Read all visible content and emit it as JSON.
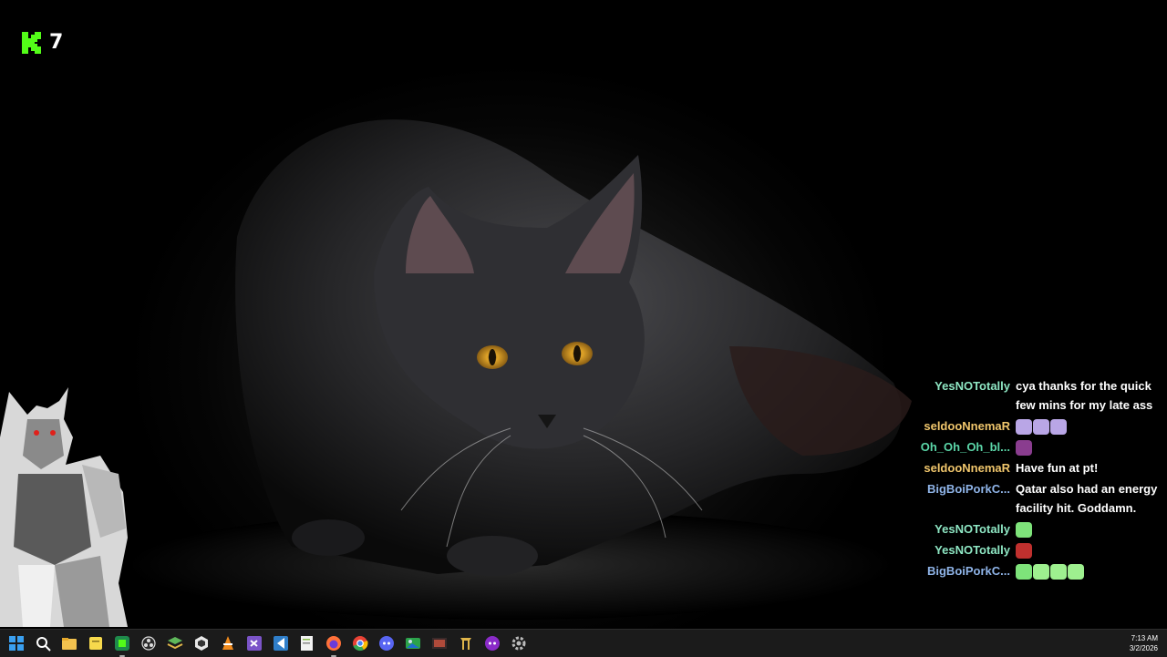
{
  "kick": {
    "viewer_count": "7"
  },
  "chat": {
    "messages": [
      {
        "user": "YesNOTotally",
        "color": "#8ee6c3",
        "text": "cya thanks for the quick few mins for my late ass"
      },
      {
        "user": "seldooNnemaR",
        "color": "#f0c66c",
        "text": "",
        "emotes": [
          "ghost-purple-emote",
          "ghost-purple-emote",
          "ghost-purple-emote"
        ]
      },
      {
        "user": "Oh_Oh_Oh_bl...",
        "color": "#5bd6a8",
        "text": "",
        "emotes": [
          "small-avatar-emote"
        ]
      },
      {
        "user": "seldooNnemaR",
        "color": "#f0c66c",
        "text": "Have fun at pt!"
      },
      {
        "user": "BigBoiPorkC...",
        "color": "#8fb4e8",
        "text": "Qatar also had an energy facility hit. Goddamn."
      },
      {
        "user": "YesNOTotally",
        "color": "#8ee6c3",
        "text": "",
        "emotes": [
          "green-frog-emote"
        ]
      },
      {
        "user": "YesNOTotally",
        "color": "#8ee6c3",
        "text": "",
        "emotes": [
          "red-face-emote"
        ]
      },
      {
        "user": "BigBoiPorkC...",
        "color": "#8fb4e8",
        "text": "",
        "emotes": [
          "green-frog-emote",
          "green-blob-emote",
          "green-blob-emote",
          "green-blob-emote"
        ]
      }
    ]
  },
  "taskbar": {
    "icons": [
      "windows-start-icon",
      "search-icon",
      "file-explorer-icon",
      "sticky-notes-icon",
      "kick-app-icon",
      "obs-icon",
      "layers-app-icon",
      "unity-icon",
      "vlc-icon",
      "visual-studio-icon",
      "visual-studio-code-icon",
      "notepad-plus-icon",
      "firefox-icon",
      "chrome-icon",
      "discord-icon",
      "photos-app-icon",
      "media-player-icon",
      "tools-icon",
      "discord-alt-icon",
      "settings-gear-icon"
    ],
    "time": "7:13 AM",
    "date": "3/2/2026"
  }
}
